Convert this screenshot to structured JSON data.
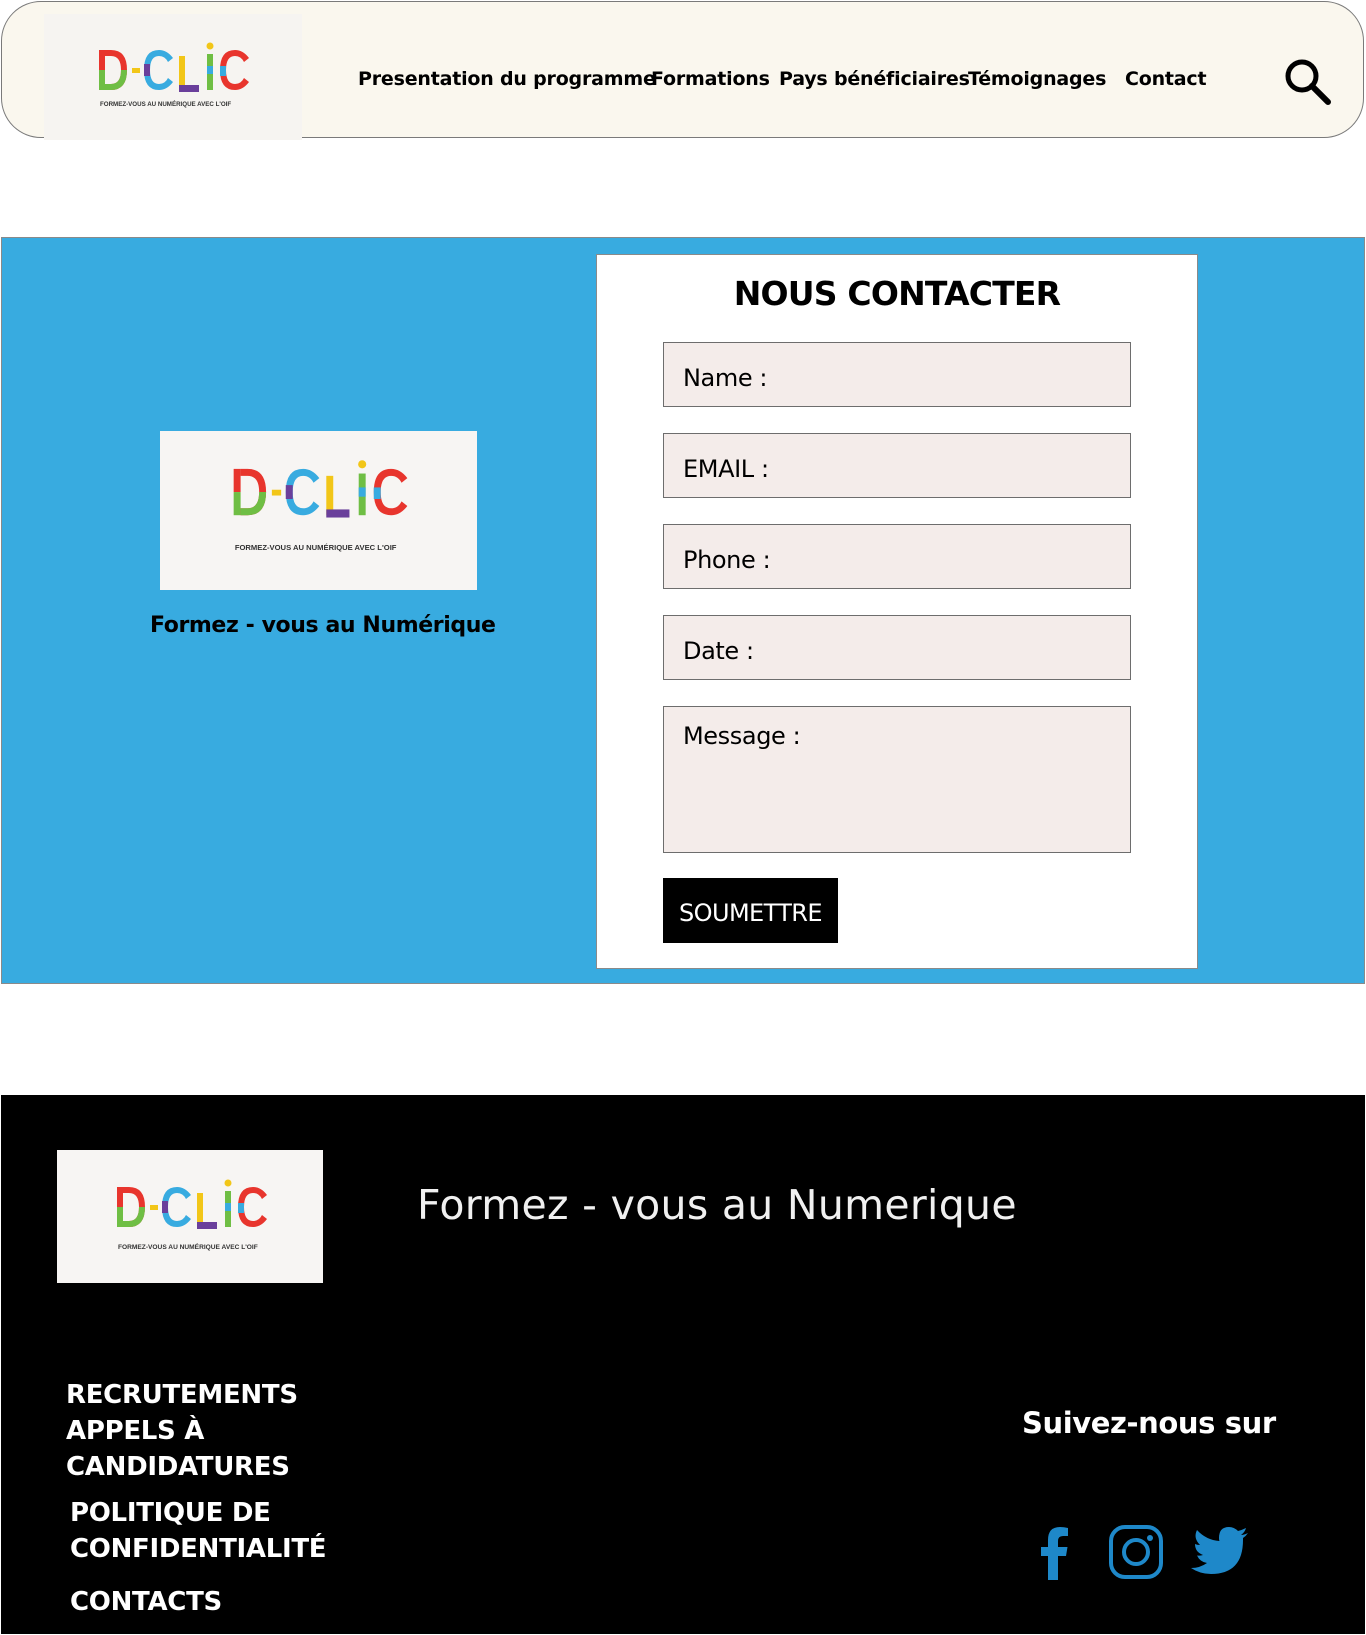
{
  "brand": {
    "logo_text": "D-CLIC",
    "logo_subtitle": "FORMEZ-VOUS AU NUMÉRIQUE AVEC L'OIF"
  },
  "nav": {
    "items": [
      {
        "label": "Presentation du programme"
      },
      {
        "label": "Formations"
      },
      {
        "label": "Pays bénéficiaires"
      },
      {
        "label": "Témoignages"
      },
      {
        "label": "Contact"
      }
    ],
    "search_icon": "search-icon"
  },
  "hero": {
    "tagline": "Formez - vous au Numérique",
    "background_color": "#38abe0"
  },
  "contact_form": {
    "title": "NOUS CONTACTER",
    "fields": [
      {
        "label": "Name :"
      },
      {
        "label": "EMAIL :"
      },
      {
        "label": "Phone :"
      },
      {
        "label": "Date :"
      },
      {
        "label": "Message :"
      }
    ],
    "submit_label": "SOUMETTRE",
    "field_background": "#f4ecea"
  },
  "footer": {
    "tagline": "Formez - vous au Numerique",
    "links": [
      {
        "label": "RECRUTEMENTS APPELS À CANDIDATURES"
      },
      {
        "label": "POLITIQUE DE CONFIDENTIALITÉ"
      },
      {
        "label": "CONTACTS"
      }
    ],
    "follow_label": "Suivez-nous sur",
    "social": [
      {
        "icon": "facebook-icon"
      },
      {
        "icon": "instagram-icon"
      },
      {
        "icon": "twitter-icon"
      }
    ],
    "social_color": "#1e88c9"
  }
}
